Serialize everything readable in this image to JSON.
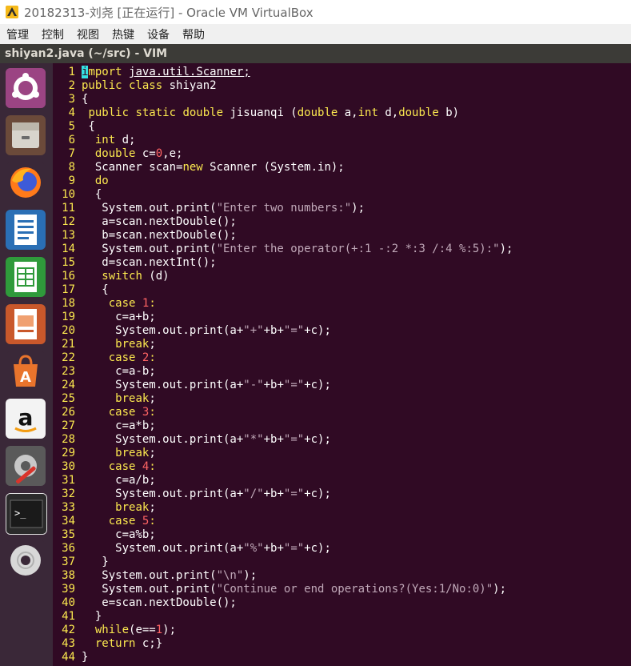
{
  "window": {
    "title": "20182313-刘尧 [正在运行] - Oracle VM VirtualBox"
  },
  "menubar": {
    "items": [
      "管理",
      "控制",
      "视图",
      "热键",
      "设备",
      "帮助"
    ]
  },
  "vim": {
    "title": "shiyan2.java (~/src) - VIM"
  },
  "launcher": {
    "items": [
      {
        "name": "dash-home-icon"
      },
      {
        "name": "files-icon"
      },
      {
        "name": "firefox-icon"
      },
      {
        "name": "libreoffice-writer-icon"
      },
      {
        "name": "libreoffice-calc-icon"
      },
      {
        "name": "libreoffice-impress-icon"
      },
      {
        "name": "ubuntu-software-icon"
      },
      {
        "name": "amazon-icon"
      },
      {
        "name": "system-settings-icon"
      },
      {
        "name": "terminal-icon"
      },
      {
        "name": "dvd-icon"
      }
    ]
  },
  "code": {
    "lines": [
      [
        [
          "c",
          "i"
        ],
        [
          "kw",
          "mport"
        ],
        [
          "t",
          " "
        ],
        [
          "ul",
          "java.util.Scanner;"
        ]
      ],
      [
        [
          "kw",
          "public class"
        ],
        [
          "t",
          " shiyan2"
        ]
      ],
      [
        [
          "t",
          "{"
        ]
      ],
      [
        [
          "t",
          " "
        ],
        [
          "kw",
          "public static double"
        ],
        [
          "t",
          " jisuanqi ("
        ],
        [
          "kw",
          "double"
        ],
        [
          "t",
          " a,"
        ],
        [
          "kw",
          "int"
        ],
        [
          "t",
          " d,"
        ],
        [
          "kw",
          "double"
        ],
        [
          "t",
          " b)"
        ]
      ],
      [
        [
          "t",
          " {"
        ]
      ],
      [
        [
          "t",
          "  "
        ],
        [
          "kw",
          "int"
        ],
        [
          "t",
          " d;"
        ]
      ],
      [
        [
          "t",
          "  "
        ],
        [
          "kw",
          "double"
        ],
        [
          "t",
          " c="
        ],
        [
          "num",
          "0"
        ],
        [
          "t",
          ",e;"
        ]
      ],
      [
        [
          "t",
          "  Scanner scan="
        ],
        [
          "kw",
          "new"
        ],
        [
          "t",
          " Scanner (System.in);"
        ]
      ],
      [
        [
          "t",
          "  "
        ],
        [
          "kw",
          "do"
        ]
      ],
      [
        [
          "t",
          "  {"
        ]
      ],
      [
        [
          "t",
          "   System.out.print("
        ],
        [
          "str",
          "\"Enter two numbers:\""
        ],
        [
          "t",
          ");"
        ]
      ],
      [
        [
          "t",
          "   a=scan.nextDouble();"
        ]
      ],
      [
        [
          "t",
          "   b=scan.nextDouble();"
        ]
      ],
      [
        [
          "t",
          "   System.out.print("
        ],
        [
          "str",
          "\"Enter the operator(+:1 -:2 *:3 /:4 %:5):\""
        ],
        [
          "t",
          ");"
        ]
      ],
      [
        [
          "t",
          "   d=scan.nextInt();"
        ]
      ],
      [
        [
          "t",
          "   "
        ],
        [
          "kw",
          "switch"
        ],
        [
          "t",
          " (d)"
        ]
      ],
      [
        [
          "t",
          "   {"
        ]
      ],
      [
        [
          "t",
          "    "
        ],
        [
          "kw",
          "case"
        ],
        [
          "t",
          " "
        ],
        [
          "num",
          "1"
        ],
        [
          "kw",
          ":"
        ]
      ],
      [
        [
          "t",
          "     c=a+b;"
        ]
      ],
      [
        [
          "t",
          "     System.out.print(a+"
        ],
        [
          "str",
          "\"+\""
        ],
        [
          "t",
          "+b+"
        ],
        [
          "str",
          "\"=\""
        ],
        [
          "t",
          "+c);"
        ]
      ],
      [
        [
          "t",
          "     "
        ],
        [
          "kw",
          "break"
        ],
        [
          "t",
          ";"
        ]
      ],
      [
        [
          "t",
          "    "
        ],
        [
          "kw",
          "case"
        ],
        [
          "t",
          " "
        ],
        [
          "num",
          "2"
        ],
        [
          "kw",
          ":"
        ]
      ],
      [
        [
          "t",
          "     c=a-b;"
        ]
      ],
      [
        [
          "t",
          "     System.out.print(a+"
        ],
        [
          "str",
          "\"-\""
        ],
        [
          "t",
          "+b+"
        ],
        [
          "str",
          "\"=\""
        ],
        [
          "t",
          "+c);"
        ]
      ],
      [
        [
          "t",
          "     "
        ],
        [
          "kw",
          "break"
        ],
        [
          "t",
          ";"
        ]
      ],
      [
        [
          "t",
          "    "
        ],
        [
          "kw",
          "case"
        ],
        [
          "t",
          " "
        ],
        [
          "num",
          "3"
        ],
        [
          "kw",
          ":"
        ]
      ],
      [
        [
          "t",
          "     c=a*b;"
        ]
      ],
      [
        [
          "t",
          "     System.out.print(a+"
        ],
        [
          "str",
          "\"*\""
        ],
        [
          "t",
          "+b+"
        ],
        [
          "str",
          "\"=\""
        ],
        [
          "t",
          "+c);"
        ]
      ],
      [
        [
          "t",
          "     "
        ],
        [
          "kw",
          "break"
        ],
        [
          "t",
          ";"
        ]
      ],
      [
        [
          "t",
          "    "
        ],
        [
          "kw",
          "case"
        ],
        [
          "t",
          " "
        ],
        [
          "num",
          "4"
        ],
        [
          "kw",
          ":"
        ]
      ],
      [
        [
          "t",
          "     c=a/b;"
        ]
      ],
      [
        [
          "t",
          "     System.out.print(a+"
        ],
        [
          "str",
          "\"/\""
        ],
        [
          "t",
          "+b+"
        ],
        [
          "str",
          "\"=\""
        ],
        [
          "t",
          "+c);"
        ]
      ],
      [
        [
          "t",
          "     "
        ],
        [
          "kw",
          "break"
        ],
        [
          "t",
          ";"
        ]
      ],
      [
        [
          "t",
          "    "
        ],
        [
          "kw",
          "case"
        ],
        [
          "t",
          " "
        ],
        [
          "num",
          "5"
        ],
        [
          "kw",
          ":"
        ]
      ],
      [
        [
          "t",
          "     c=a%b;"
        ]
      ],
      [
        [
          "t",
          "     System.out.print(a+"
        ],
        [
          "str",
          "\"%\""
        ],
        [
          "t",
          "+b+"
        ],
        [
          "str",
          "\"=\""
        ],
        [
          "t",
          "+c);"
        ]
      ],
      [
        [
          "t",
          "   }"
        ]
      ],
      [
        [
          "t",
          "   System.out.print("
        ],
        [
          "str",
          "\"\\n\""
        ],
        [
          "t",
          ");"
        ]
      ],
      [
        [
          "t",
          "   System.out.print("
        ],
        [
          "str",
          "\"Continue or end operations?(Yes:1/No:0)\""
        ],
        [
          "t",
          ");"
        ]
      ],
      [
        [
          "t",
          "   e=scan.nextDouble();"
        ]
      ],
      [
        [
          "t",
          "  }"
        ]
      ],
      [
        [
          "t",
          "  "
        ],
        [
          "kw",
          "while"
        ],
        [
          "t",
          "(e=="
        ],
        [
          "num",
          "1"
        ],
        [
          "t",
          ");"
        ]
      ],
      [
        [
          "t",
          "  "
        ],
        [
          "kw",
          "return"
        ],
        [
          "t",
          " c;}"
        ]
      ],
      [
        [
          "t",
          "}"
        ]
      ]
    ]
  }
}
